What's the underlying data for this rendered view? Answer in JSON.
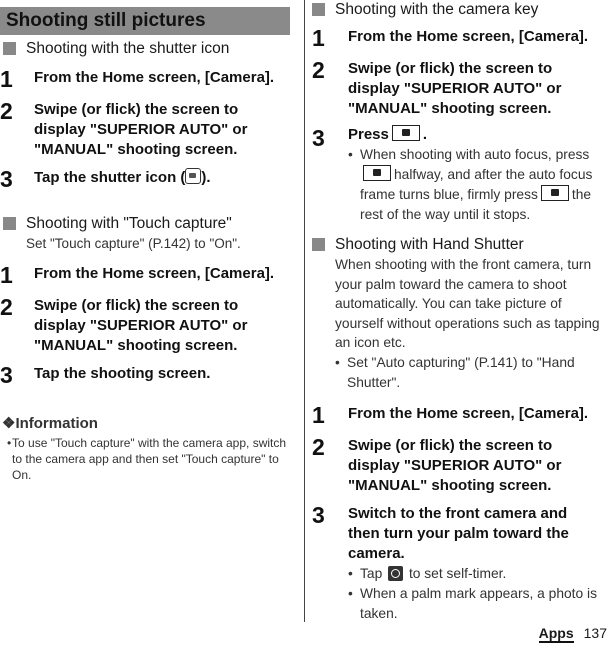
{
  "title": "Shooting still pictures",
  "left": {
    "section1": {
      "heading": "Shooting with the shutter icon",
      "steps": [
        {
          "num": "1",
          "text": "From the Home screen, [Camera]."
        },
        {
          "num": "2",
          "text": "Swipe (or flick) the screen to display \"SUPERIOR AUTO\" or \"MANUAL\" shooting screen."
        },
        {
          "num": "3",
          "text_before": "Tap the shutter icon (",
          "text_after": ")."
        }
      ]
    },
    "section2": {
      "heading": "Shooting with \"Touch capture\"",
      "desc": "Set \"Touch capture\" (P.142) to \"On\".",
      "steps": [
        {
          "num": "1",
          "text": "From the Home screen, [Camera]."
        },
        {
          "num": "2",
          "text": "Swipe (or flick) the screen to display \"SUPERIOR AUTO\" or \"MANUAL\" shooting screen."
        },
        {
          "num": "3",
          "text": "Tap the shooting screen."
        }
      ]
    },
    "info": {
      "heading": "❖Information",
      "bullets": [
        "To use \"Touch capture\" with the camera app, switch to the camera app and then set \"Touch capture\" to On."
      ]
    }
  },
  "right": {
    "section1": {
      "heading": "Shooting with the camera key",
      "steps": [
        {
          "num": "1",
          "text": "From the Home screen, [Camera]."
        },
        {
          "num": "2",
          "text": "Swipe (or flick) the screen to display \"SUPERIOR AUTO\" or \"MANUAL\" shooting screen."
        },
        {
          "num": "3",
          "text_before": "Press",
          "text_after": "."
        }
      ],
      "bullet": {
        "p1": "When shooting with auto focus, press",
        "p2": "halfway, and after the auto focus frame turns blue, firmly press",
        "p3": "the rest of the way until it stops."
      }
    },
    "section2": {
      "heading": "Shooting with Hand Shutter",
      "desc": "When shooting with the front camera, turn your palm toward the camera to shoot automatically. You can take picture of yourself without operations such as tapping an icon etc.",
      "bullet": "Set \"Auto capturing\" (P.141) to \"Hand Shutter\".",
      "steps": [
        {
          "num": "1",
          "text": "From the Home screen, [Camera]."
        },
        {
          "num": "2",
          "text": "Swipe (or flick) the screen to display \"SUPERIOR AUTO\" or \"MANUAL\" shooting screen."
        },
        {
          "num": "3",
          "text": "Switch to the front camera and then turn your palm toward the camera."
        }
      ],
      "step3_bullets": {
        "b1_before": "Tap",
        "b1_after": "to set self-timer.",
        "b2": "When a palm mark appears, a photo is taken."
      }
    }
  },
  "footer": {
    "section": "Apps",
    "page": "137"
  }
}
